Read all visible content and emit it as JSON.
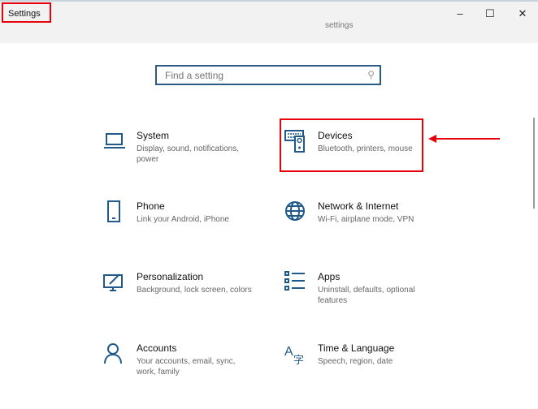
{
  "window": {
    "title": "Settings",
    "ghost_title": "settings",
    "minimize": "–",
    "maximize": "☐",
    "close": "✕"
  },
  "search": {
    "placeholder": "Find a setting",
    "icon": "search-icon"
  },
  "items": [
    {
      "title": "System",
      "subtitle": "Display, sound, notifications, power",
      "icon": "laptop-icon"
    },
    {
      "title": "Devices",
      "subtitle": "Bluetooth, printers, mouse",
      "icon": "devices-icon"
    },
    {
      "title": "Phone",
      "subtitle": "Link your Android, iPhone",
      "icon": "phone-icon"
    },
    {
      "title": "Network & Internet",
      "subtitle": "Wi-Fi, airplane mode, VPN",
      "icon": "globe-icon"
    },
    {
      "title": "Personalization",
      "subtitle": "Background, lock screen, colors",
      "icon": "personalization-icon"
    },
    {
      "title": "Apps",
      "subtitle": "Uninstall, defaults, optional features",
      "icon": "apps-icon"
    },
    {
      "title": "Accounts",
      "subtitle": "Your accounts, email, sync, work, family",
      "icon": "person-icon"
    },
    {
      "title": "Time & Language",
      "subtitle": "Speech, region, date",
      "icon": "time-language-icon"
    }
  ],
  "colors": {
    "accent": "#1f5a8a",
    "annotation": "#e8000b"
  }
}
